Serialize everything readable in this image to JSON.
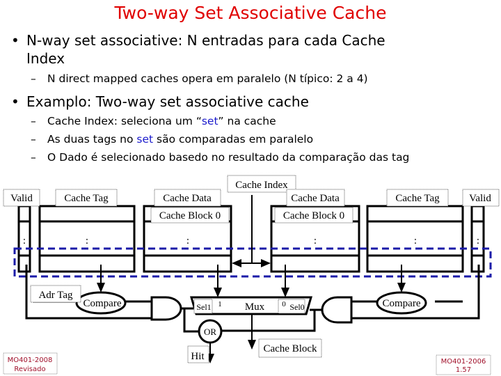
{
  "title": "Two-way Set Associative Cache",
  "bullets": [
    {
      "text_line1": "N-way set associative: N entradas para cada Cache",
      "text_line2": "Index",
      "sub": [
        "N direct mapped caches opera em paralelo (N típico: 2 a 4)"
      ]
    },
    {
      "text_line1": "Examplo: Two-way set associative cache",
      "sub": [
        {
          "pre": "Cache Index: seleciona um “",
          "hl": "set",
          "post": "” na cache"
        },
        {
          "pre": "As duas tags no ",
          "hl": "set",
          "post": " são comparadas em paralelo"
        },
        {
          "pre": "O Dado é selecionado basedo no resultado da comparação das tag",
          "hl": "",
          "post": ""
        }
      ]
    }
  ],
  "diagram": {
    "valid": "Valid",
    "cache_tag": "Cache Tag",
    "cache_data": "Cache Data",
    "cache_block_0": "Cache Block 0",
    "cache_index": "Cache Index",
    "ellipsis": ":",
    "adr_tag": "Adr Tag",
    "compare": "Compare",
    "sel1": "Sel1",
    "sel1_in": "1",
    "mux": "Mux",
    "sel0": "Sel0",
    "sel0_in": "0",
    "or": "OR",
    "hit": "Hit",
    "cache_block": "Cache Block",
    "highlight_color": "#1a1aa8"
  },
  "footer": {
    "left_line1": "MO401-2008",
    "left_line2": "Revisado",
    "right_line1": "MO401-2006",
    "right_line2": "1.57",
    "color": "#a0102a"
  },
  "colors": {
    "title": "#e00000",
    "highlight": "#1a1acc"
  }
}
